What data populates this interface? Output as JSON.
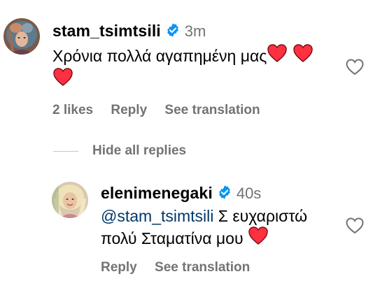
{
  "comments": [
    {
      "username": "stam_tsimtsili",
      "time": "3m",
      "text_line1": "Χρόνια πολλά αγαπημένη μας",
      "likes": "2 likes",
      "reply_label": "Reply",
      "translate_label": "See translation"
    }
  ],
  "hide_replies_label": "Hide all replies",
  "replies": [
    {
      "username": "elenimenegaki",
      "time": "40s",
      "mention": "@stam_tsimtsili",
      "text_line1_rest": " Σ ευχαριστώ",
      "text_line2": "πολύ Σταματίνα μου",
      "reply_label": "Reply",
      "translate_label": "See translation"
    }
  ],
  "colors": {
    "verified": "#0095f6",
    "heart": "#ff3040",
    "secondary_text": "#737373",
    "mention": "#00376b"
  },
  "icons": {
    "verified": "verified-badge-icon",
    "like": "heart-outline-icon",
    "emoji": "red-heart-emoji"
  }
}
